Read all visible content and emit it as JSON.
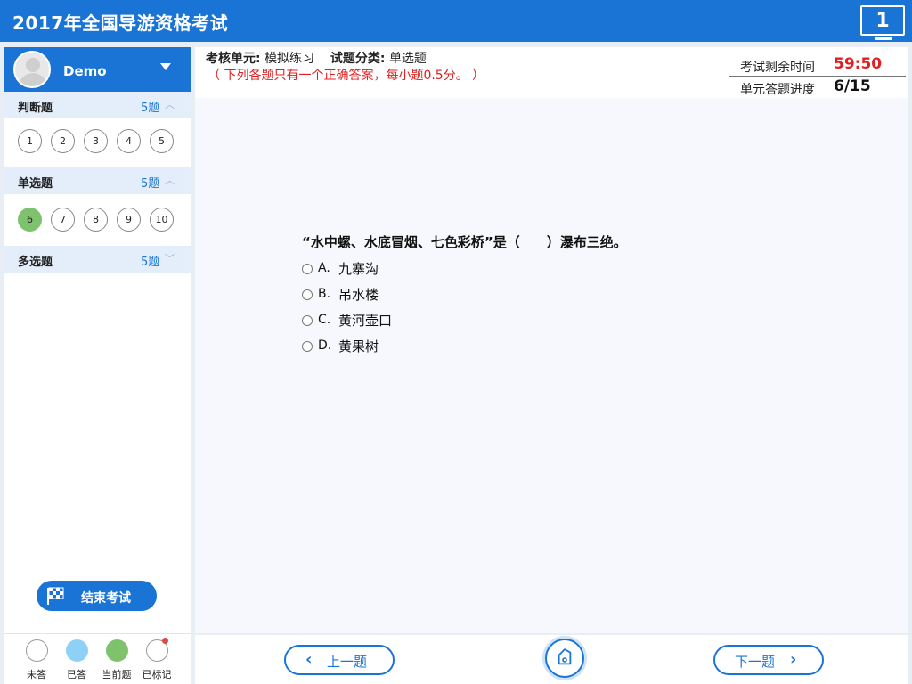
{
  "app": {
    "title": "2017年全国导游资格考试",
    "screen_number": "1"
  },
  "user": {
    "name": "Demo"
  },
  "sections": [
    {
      "label": "判断题",
      "count": "5题",
      "expanded": true,
      "questions": [
        "1",
        "2",
        "3",
        "4",
        "5"
      ]
    },
    {
      "label": "单选题",
      "count": "5题",
      "expanded": true,
      "questions": [
        "6",
        "7",
        "8",
        "9",
        "10"
      ],
      "current": "6"
    },
    {
      "label": "多选题",
      "count": "5题",
      "expanded": false
    }
  ],
  "actions": {
    "end_exam": "结束考试",
    "prev": "上一题",
    "next": "下一题"
  },
  "legend": {
    "unanswered": "未答",
    "answered": "已答",
    "current": "当前题",
    "marked": "已标记"
  },
  "info": {
    "unit_label": "考核单元:",
    "unit_value": "模拟练习",
    "category_label": "试题分类:",
    "category_value": "单选题",
    "note": "（ 下列各题只有一个正确答案，每小题0.5分。 ）",
    "time_label": "考试剩余时间",
    "time_value": "59:50",
    "progress_label": "单元答题进度",
    "progress_value": "6/15"
  },
  "question": {
    "text": "“水中螺、水底冒烟、七色彩桥”是（　　）瀑布三绝。",
    "options": [
      {
        "letter": "A.",
        "text": "九寨沟"
      },
      {
        "letter": "B.",
        "text": "吊水楼"
      },
      {
        "letter": "C.",
        "text": "黄河壶口"
      },
      {
        "letter": "D.",
        "text": "黄果树"
      }
    ]
  },
  "colors": {
    "primary": "#1a74d6",
    "timer": "#e02020",
    "current": "#7ec26e",
    "answered": "#8fd0f6"
  }
}
